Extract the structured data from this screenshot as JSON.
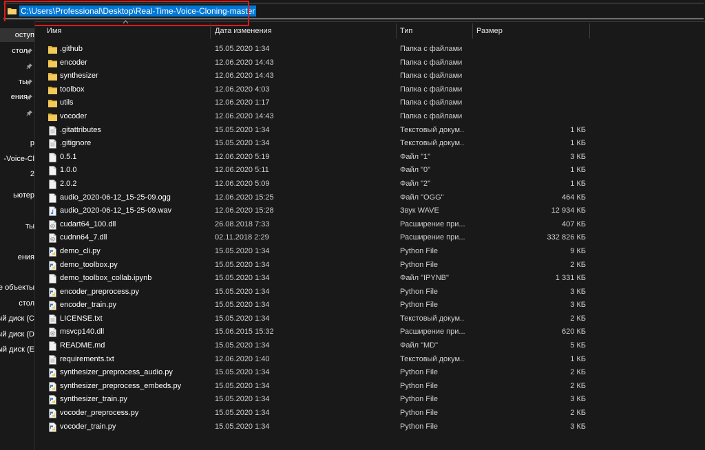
{
  "address_bar": {
    "path": "C:\\Users\\Professional\\Desktop\\Real-Time-Voice-Cloning-master"
  },
  "nav_pane": {
    "items": [
      {
        "label": "оступ",
        "pinned": false,
        "selected": true
      },
      {
        "label": "стол",
        "pinned": true
      },
      {
        "label": "",
        "pinned": true
      },
      {
        "label": "ты",
        "pinned": true
      },
      {
        "label": "ения",
        "pinned": true
      },
      {
        "label": "",
        "pinned": true
      },
      {
        "label": "",
        "pinned": false
      },
      {
        "label": "р",
        "pinned": false
      },
      {
        "label": "-Voice-Cl",
        "pinned": false
      },
      {
        "label": "2",
        "pinned": false
      },
      {
        "label": "",
        "pinned": false
      },
      {
        "label": "ьютер",
        "pinned": false
      },
      {
        "label": "",
        "pinned": false
      },
      {
        "label": "ты",
        "pinned": false
      },
      {
        "label": "",
        "pinned": false
      },
      {
        "label": "",
        "pinned": false
      },
      {
        "label": "ения",
        "pinned": false
      },
      {
        "label": "",
        "pinned": false
      },
      {
        "label": "е объекты",
        "pinned": false
      },
      {
        "label": "стол",
        "pinned": false
      },
      {
        "label": "ый диск (C",
        "pinned": false
      },
      {
        "label": "ый диск (D",
        "pinned": false
      },
      {
        "label": "ый диск (E",
        "pinned": false
      }
    ]
  },
  "columns": {
    "name": "Имя",
    "date": "Дата изменения",
    "type": "Тип",
    "size": "Размер"
  },
  "files": [
    {
      "name": ".github",
      "date": "15.05.2020 1:34",
      "type": "Папка с файлами",
      "size": "",
      "icon": "folder-icon"
    },
    {
      "name": "encoder",
      "date": "12.06.2020 14:43",
      "type": "Папка с файлами",
      "size": "",
      "icon": "folder-icon"
    },
    {
      "name": "synthesizer",
      "date": "12.06.2020 14:43",
      "type": "Папка с файлами",
      "size": "",
      "icon": "folder-icon"
    },
    {
      "name": "toolbox",
      "date": "12.06.2020 4:03",
      "type": "Папка с файлами",
      "size": "",
      "icon": "folder-icon"
    },
    {
      "name": "utils",
      "date": "12.06.2020 1:17",
      "type": "Папка с файлами",
      "size": "",
      "icon": "folder-icon"
    },
    {
      "name": "vocoder",
      "date": "12.06.2020 14:43",
      "type": "Папка с файлами",
      "size": "",
      "icon": "folder-icon"
    },
    {
      "name": ".gitattributes",
      "date": "15.05.2020 1:34",
      "type": "Текстовый докум...",
      "size": "1 КБ",
      "icon": "text-file-icon"
    },
    {
      "name": ".gitignore",
      "date": "15.05.2020 1:34",
      "type": "Текстовый докум...",
      "size": "1 КБ",
      "icon": "text-file-icon"
    },
    {
      "name": "0.5.1",
      "date": "12.06.2020 5:19",
      "type": "Файл \"1\"",
      "size": "3 КБ",
      "icon": "file-icon"
    },
    {
      "name": "1.0.0",
      "date": "12.06.2020 5:11",
      "type": "Файл \"0\"",
      "size": "1 КБ",
      "icon": "file-icon"
    },
    {
      "name": "2.0.2",
      "date": "12.06.2020 5:09",
      "type": "Файл \"2\"",
      "size": "1 КБ",
      "icon": "file-icon"
    },
    {
      "name": "audio_2020-06-12_15-25-09.ogg",
      "date": "12.06.2020 15:25",
      "type": "Файл \"OGG\"",
      "size": "464 КБ",
      "icon": "file-icon"
    },
    {
      "name": "audio_2020-06-12_15-25-09.wav",
      "date": "12.06.2020 15:28",
      "type": "Звук WAVE",
      "size": "12 934 КБ",
      "icon": "audio-file-icon"
    },
    {
      "name": "cudart64_100.dll",
      "date": "26.08.2018 7:33",
      "type": "Расширение при...",
      "size": "407 КБ",
      "icon": "dll-file-icon"
    },
    {
      "name": "cudnn64_7.dll",
      "date": "02.11.2018 2:29",
      "type": "Расширение при...",
      "size": "332 826 КБ",
      "icon": "dll-file-icon"
    },
    {
      "name": "demo_cli.py",
      "date": "15.05.2020 1:34",
      "type": "Python File",
      "size": "9 КБ",
      "icon": "python-file-icon"
    },
    {
      "name": "demo_toolbox.py",
      "date": "15.05.2020 1:34",
      "type": "Python File",
      "size": "2 КБ",
      "icon": "python-file-icon"
    },
    {
      "name": "demo_toolbox_collab.ipynb",
      "date": "15.05.2020 1:34",
      "type": "Файл \"IPYNB\"",
      "size": "1 331 КБ",
      "icon": "file-icon"
    },
    {
      "name": "encoder_preprocess.py",
      "date": "15.05.2020 1:34",
      "type": "Python File",
      "size": "3 КБ",
      "icon": "python-file-icon"
    },
    {
      "name": "encoder_train.py",
      "date": "15.05.2020 1:34",
      "type": "Python File",
      "size": "3 КБ",
      "icon": "python-file-icon"
    },
    {
      "name": "LICENSE.txt",
      "date": "15.05.2020 1:34",
      "type": "Текстовый докум...",
      "size": "2 КБ",
      "icon": "text-file-icon"
    },
    {
      "name": "msvcp140.dll",
      "date": "15.06.2015 15:32",
      "type": "Расширение при...",
      "size": "620 КБ",
      "icon": "dll-file-icon"
    },
    {
      "name": "README.md",
      "date": "15.05.2020 1:34",
      "type": "Файл \"MD\"",
      "size": "5 КБ",
      "icon": "file-icon"
    },
    {
      "name": "requirements.txt",
      "date": "12.06.2020 1:40",
      "type": "Текстовый докум...",
      "size": "1 КБ",
      "icon": "text-file-icon"
    },
    {
      "name": "synthesizer_preprocess_audio.py",
      "date": "15.05.2020 1:34",
      "type": "Python File",
      "size": "2 КБ",
      "icon": "python-file-icon"
    },
    {
      "name": "synthesizer_preprocess_embeds.py",
      "date": "15.05.2020 1:34",
      "type": "Python File",
      "size": "2 КБ",
      "icon": "python-file-icon"
    },
    {
      "name": "synthesizer_train.py",
      "date": "15.05.2020 1:34",
      "type": "Python File",
      "size": "3 КБ",
      "icon": "python-file-icon"
    },
    {
      "name": "vocoder_preprocess.py",
      "date": "15.05.2020 1:34",
      "type": "Python File",
      "size": "2 КБ",
      "icon": "python-file-icon"
    },
    {
      "name": "vocoder_train.py",
      "date": "15.05.2020 1:34",
      "type": "Python File",
      "size": "3 КБ",
      "icon": "python-file-icon"
    }
  ],
  "colors": {
    "background": "#191919",
    "selection": "#0078d7",
    "highlight_box": "#e01b1b",
    "folder": "#f0c34a"
  }
}
